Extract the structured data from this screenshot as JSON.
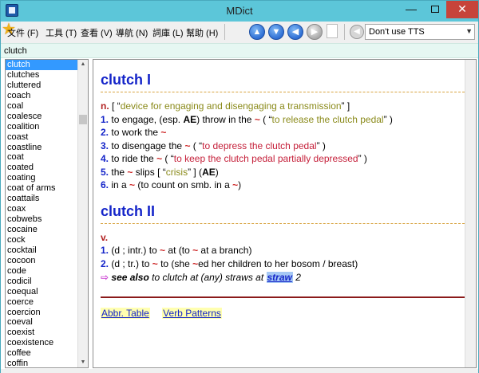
{
  "window": {
    "title": "MDict",
    "minimize": "—",
    "close": "✕"
  },
  "menu": [
    {
      "label": "文件 (F)"
    },
    {
      "label": "工具 (T)"
    },
    {
      "label": "查看 (V)"
    },
    {
      "label": "導航 (N)"
    },
    {
      "label": "詞庫 (L)"
    },
    {
      "label": "幫助 (H)"
    }
  ],
  "toolbar": {
    "star_icon": "star-icon",
    "arrow_up": "▲",
    "arrow_down": "▼",
    "arrow_back": "◀",
    "arrow_forward": "▶",
    "tts_icon": "◀",
    "tts_value": "Don't use TTS",
    "tts_arrow": "▼"
  },
  "search": {
    "value": "clutch"
  },
  "wordlist": {
    "items": [
      "clutch",
      "clutches",
      "cluttered",
      "coach",
      "coal",
      "coalesce",
      "coalition",
      "coast",
      "coastline",
      "coat",
      "coated",
      "coating",
      "coat of arms",
      "coattails",
      "coax",
      "cobwebs",
      "cocaine",
      "cock",
      "cocktail",
      "cocoon",
      "code",
      "codicil",
      "coequal",
      "coerce",
      "coercion",
      "coeval",
      "coexist",
      "coexistence",
      "coffee",
      "coffin"
    ],
    "selected_index": 0,
    "scroll_up": "▲",
    "scroll_down": "▼"
  },
  "entry": {
    "headword1": "clutch I",
    "noun": {
      "pos": "n.",
      "open": "[ “",
      "definition": "device for engaging and disengaging a transmission",
      "close": "” ]"
    },
    "senses1": [
      {
        "num": "1.",
        "pre": "to engage, (esp. ",
        "bold": "AE",
        "post": ") throw in the ",
        "tilde": "~",
        "after": " ( “",
        "example": "to release the clutch pedal",
        "end": "” )"
      },
      {
        "num": "2.",
        "pre": "to work the ",
        "tilde": "~"
      },
      {
        "num": "3.",
        "pre": "to disengage the ",
        "tilde": "~",
        "after": " ( “",
        "example": "to depress the clutch pedal",
        "end": "” )"
      },
      {
        "num": "4.",
        "pre": "to ride the ",
        "tilde": "~",
        "after": " ( “",
        "example": "to keep the clutch pedal partially depressed",
        "end": "” )"
      },
      {
        "num": "5.",
        "pre": "the ",
        "tilde": "~",
        "post": " slips [ “",
        "example": "crisis",
        "end": "” ] (",
        "bold": "AE",
        "end2": ")"
      },
      {
        "num": "6.",
        "pre": "in a ",
        "tilde": "~",
        "post": " (to count on smb. in a ",
        "tilde2": "~",
        "end": ")"
      }
    ],
    "headword2": "clutch II",
    "verb": {
      "pos": "v."
    },
    "senses2": [
      {
        "num": "1.",
        "pre": "(d ; intr.) to ",
        "tilde": "~",
        "post": " at (to ",
        "tilde2": "~",
        "end": " at a branch)"
      },
      {
        "num": "2.",
        "pre": "(d ; tr.) to ",
        "tilde": "~",
        "post": " to (she ",
        "tilde2": "~",
        "end": "ed her children to her bosom / breast)"
      }
    ],
    "see_also": {
      "arrow": "⇨",
      "label": "see also",
      "text": " to clutch at (any) straws at ",
      "link": "straw",
      "suffix": " 2"
    },
    "links": [
      {
        "label": "Abbr. Table"
      },
      {
        "label": "Verb Patterns"
      }
    ]
  }
}
